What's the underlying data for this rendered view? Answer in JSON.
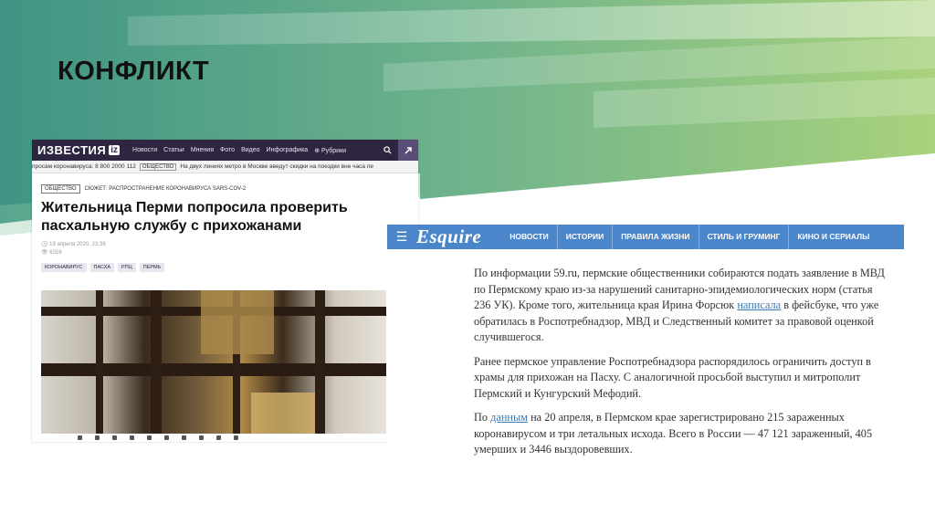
{
  "slide": {
    "title": "КОНФЛИКТ"
  },
  "izvestia": {
    "logo": "ИЗВЕСТИЯ",
    "logo_badge": "iz",
    "nav": [
      "Новости",
      "Статьи",
      "Мнения",
      "Фото",
      "Видео",
      "Инфографика",
      "⊕ Рубрики"
    ],
    "ticker_text": "просам коронавируса: 8 800 2000 112",
    "ticker_tag": "ОБЩЕСТВО",
    "ticker_news": "На двух линиях метро в Москве введут скидки на поездки вне часа пе",
    "rubric_chip": "ОБЩЕСТВО",
    "rubric_story": "СЮЖЕТ: РАСПРОСТРАНЕНИЕ КОРОНАВИРУСА SARS-COV-2",
    "headline": "Жительница Перми попросила проверить пасхальную службу с прихожанами",
    "date": "19 апреля 2020, 23:39",
    "views": "6318",
    "tags": [
      "КОРОНАВИРУС",
      "ПАСХА",
      "РПЦ",
      "ПЕРМЬ"
    ]
  },
  "share": {
    "buttons": [
      "f",
      "vk",
      "ok",
      "tw",
      "tg"
    ]
  },
  "esquire": {
    "logo": "Esquire",
    "nav": [
      "НОВОСТИ",
      "ИСТОРИИ",
      "ПРАВИЛА ЖИЗНИ",
      "СТИЛЬ И ГРУМИНГ",
      "КИНО И СЕРИАЛЫ"
    ],
    "p1a": "По информации 59.ru, пермские общественники собираются подать заявление в МВД по Пермскому краю из-за нарушений санитарно-эпидемиологических норм (статья 236 УК). Кроме того, жительница края Ирина Форсюк ",
    "p1_link": "написала",
    "p1b": " в фейсбуке, что уже обратилась в Роспотребнадзор, МВД и Следственный комитет за правовой оценкой случившегося.",
    "p2": "Ранее пермское управление Роспотребнадзора распорядилось ограничить доступ в храмы для прихожан на Пасху. С аналогичной просьбой выступил и митрополит Пермский и Кунгурский Мефодий.",
    "p3a": "По ",
    "p3_link": "данным",
    "p3b": " на 20 апреля, в Пермском крае зарегистрировано 215 зараженных коронавирусом и три летальных исхода. Всего в России — 47 121 зараженный, 405 умерших и 3446 выздоровевших."
  },
  "colors": {
    "teal": "#4f9f8b",
    "green": "#9ccc7a",
    "esquire_blue": "#4a86c9",
    "izvestia_purple": "#2e2540"
  }
}
